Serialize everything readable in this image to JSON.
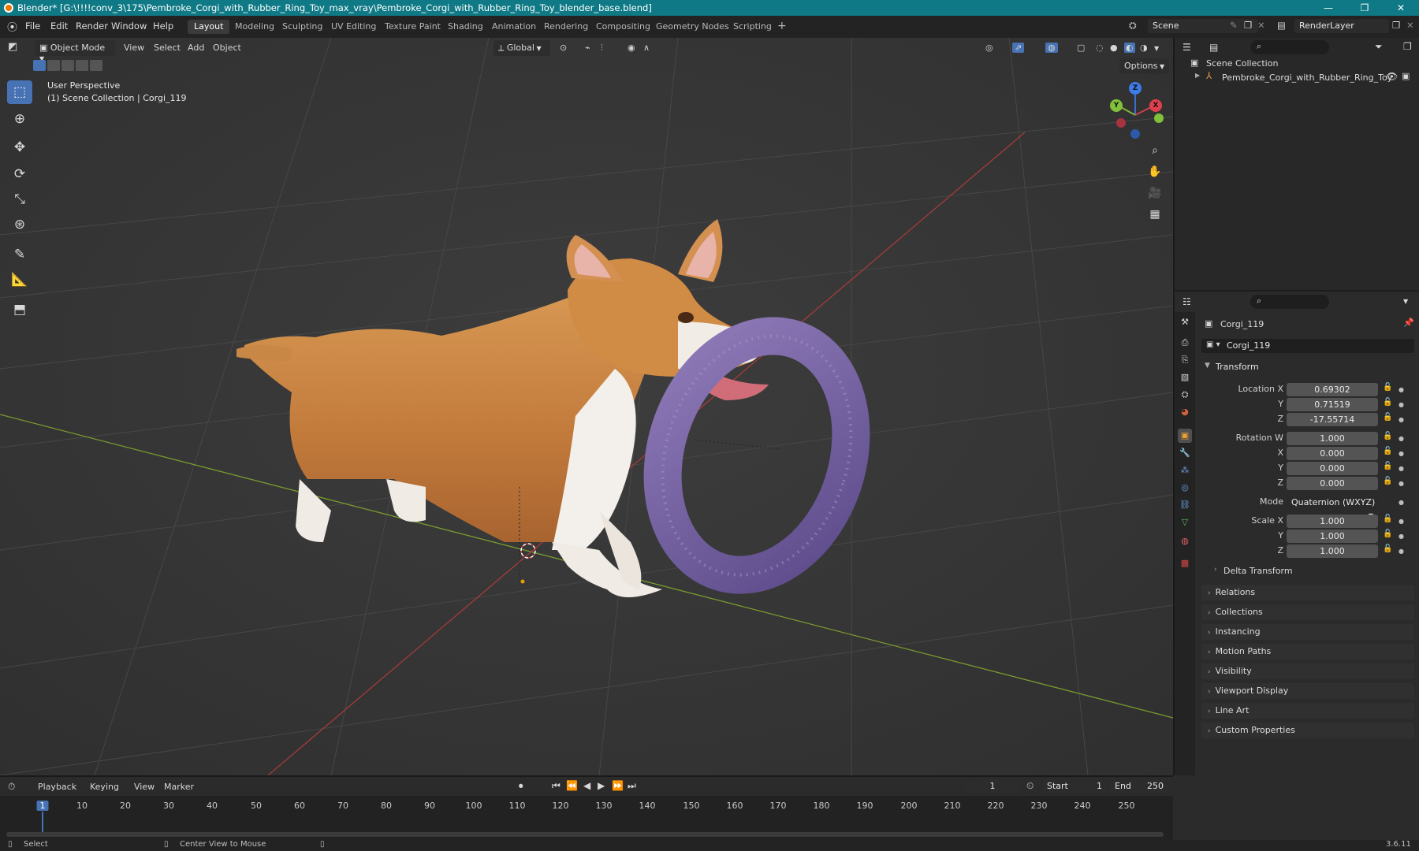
{
  "titlebar": {
    "title": "Blender* [G:\\!!!!conv_3\\175\\Pembroke_Corgi_with_Rubber_Ring_Toy_max_vray\\Pembroke_Corgi_with_Rubber_Ring_Toy_blender_base.blend]",
    "minimize": "—",
    "maximize": "❐",
    "close": "✕"
  },
  "menubar": {
    "items": [
      "File",
      "Edit",
      "Render",
      "Window",
      "Help"
    ],
    "workspaces": [
      "Layout",
      "Modeling",
      "Sculpting",
      "UV Editing",
      "Texture Paint",
      "Shading",
      "Animation",
      "Rendering",
      "Compositing",
      "Geometry Nodes",
      "Scripting"
    ],
    "active_workspace": "Layout",
    "add_tab": "+",
    "scene": "Scene",
    "render_layer": "RenderLayer"
  },
  "viewport": {
    "mode": "Object Mode",
    "menus": [
      "View",
      "Select",
      "Add",
      "Object"
    ],
    "orientation": "Global",
    "options": "Options",
    "perspective": "User Perspective",
    "collection_info": "(1) Scene Collection | Corgi_119",
    "gizmo": {
      "x": "X",
      "y": "Y",
      "z": "Z"
    }
  },
  "outliner": {
    "scene_collection": "Scene Collection",
    "object": "Pembroke_Corgi_with_Rubber_Ring_Toy"
  },
  "properties": {
    "object_name": "Corgi_119",
    "data_name": "Corgi_119",
    "transform_label": "Transform",
    "location_label": "Location X",
    "location": {
      "x": "0.69302",
      "y": "0.71519",
      "z": "-17.55714"
    },
    "rotation_label": "Rotation W",
    "rotation": {
      "w": "1.000",
      "x": "0.000",
      "y": "0.000",
      "z": "0.000"
    },
    "mode_label": "Mode",
    "mode_value": "Quaternion (WXYZ)",
    "scale_label": "Scale X",
    "scale": {
      "x": "1.000",
      "y": "1.000",
      "z": "1.000"
    },
    "axis_y": "Y",
    "axis_x": "X",
    "axis_z": "Z",
    "delta_transform": "Delta Transform",
    "panels": [
      "Relations",
      "Collections",
      "Instancing",
      "Motion Paths",
      "Visibility",
      "Viewport Display",
      "Line Art",
      "Custom Properties"
    ]
  },
  "timeline": {
    "menus": [
      "Playback",
      "Keying",
      "View",
      "Marker"
    ],
    "current_frame": "1",
    "start_label": "Start",
    "start": "1",
    "end_label": "End",
    "end": "250",
    "ticks": [
      "1",
      "10",
      "20",
      "30",
      "40",
      "50",
      "60",
      "70",
      "80",
      "90",
      "100",
      "110",
      "120",
      "130",
      "140",
      "150",
      "160",
      "170",
      "180",
      "190",
      "200",
      "210",
      "220",
      "230",
      "240",
      "250"
    ]
  },
  "statusbar": {
    "select": "Select",
    "center_view": "Center View to Mouse",
    "version": "3.6.11"
  }
}
